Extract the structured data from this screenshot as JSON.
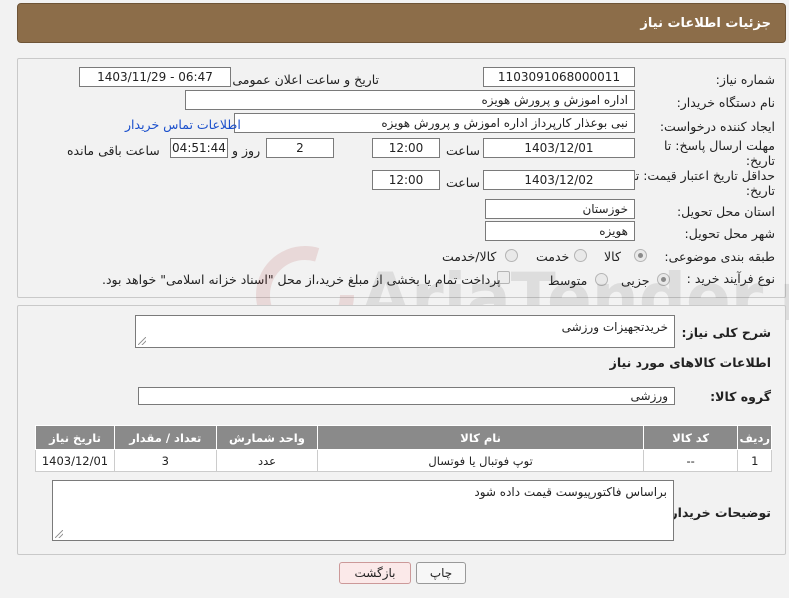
{
  "header": {
    "title": "جزئیات اطلاعات نیاز"
  },
  "form": {
    "need_number_label": "شماره نیاز:",
    "need_number": "1103091068000011",
    "announce_label": "تاریخ و ساعت اعلان عمومی:",
    "announce_value": "1403/11/29 - 06:47",
    "buyer_org_label": "نام دستگاه خریدار:",
    "buyer_org": "اداره اموزش و پرورش هویزه",
    "creator_label": "ایجاد کننده درخواست:",
    "creator": "نبی بوعذار کارپرداز اداره اموزش و پرورش هویزه",
    "contact_link": "اطلاعات تماس خریدار",
    "deadline_label_1": "مهلت ارسال پاسخ: تا",
    "deadline_label_2": "تاریخ:",
    "deadline_date": "1403/12/01",
    "time_label": "ساعت",
    "deadline_time": "12:00",
    "days": "2",
    "days_label": "روز و",
    "remaining": "04:51:44",
    "remaining_label": "ساعت باقی مانده",
    "validity_label_1": "حداقل تاریخ اعتبار قیمت: تا",
    "validity_label_2": "تاریخ:",
    "validity_date": "1403/12/02",
    "validity_time": "12:00",
    "province_label": "استان محل تحویل:",
    "province": "خوزستان",
    "city_label": "شهر محل تحویل:",
    "city": "هویزه",
    "category_label": "طبقه بندی موضوعی:",
    "category_options": [
      "کالا",
      "خدمت",
      "کالا/خدمت"
    ],
    "category_selected": "کالا",
    "process_label": "نوع فرآیند خرید :",
    "process_options": [
      "جزیی",
      "متوسط"
    ],
    "payment_note": "پرداخت تمام یا بخشی از مبلغ خرید،از محل \"اسناد خزانه اسلامی\" خواهد بود."
  },
  "details": {
    "description_label": "شرح کلی نیاز:",
    "description": "خریدتجهیزات ورزشی",
    "goods_info_title": "اطلاعات کالاهای مورد نیاز",
    "goods_group_label": "گروه کالا:",
    "goods_group": "ورزشی",
    "table": {
      "headers": [
        "ردیف",
        "کد کالا",
        "نام کالا",
        "واحد شمارش",
        "تعداد / مقدار",
        "تاریخ نیاز"
      ],
      "rows": [
        [
          "1",
          "--",
          "توپ فوتبال یا فوتسال",
          "عدد",
          "3",
          "1403/12/01"
        ]
      ]
    },
    "buyer_notes_label": "توضیحات خریدار:",
    "buyer_notes": "براساس فاکتورپیوست قیمت داده شود"
  },
  "buttons": {
    "print": "چاپ",
    "back": "بازگشت"
  },
  "watermark": {
    "text": "AriaTender.neT"
  }
}
